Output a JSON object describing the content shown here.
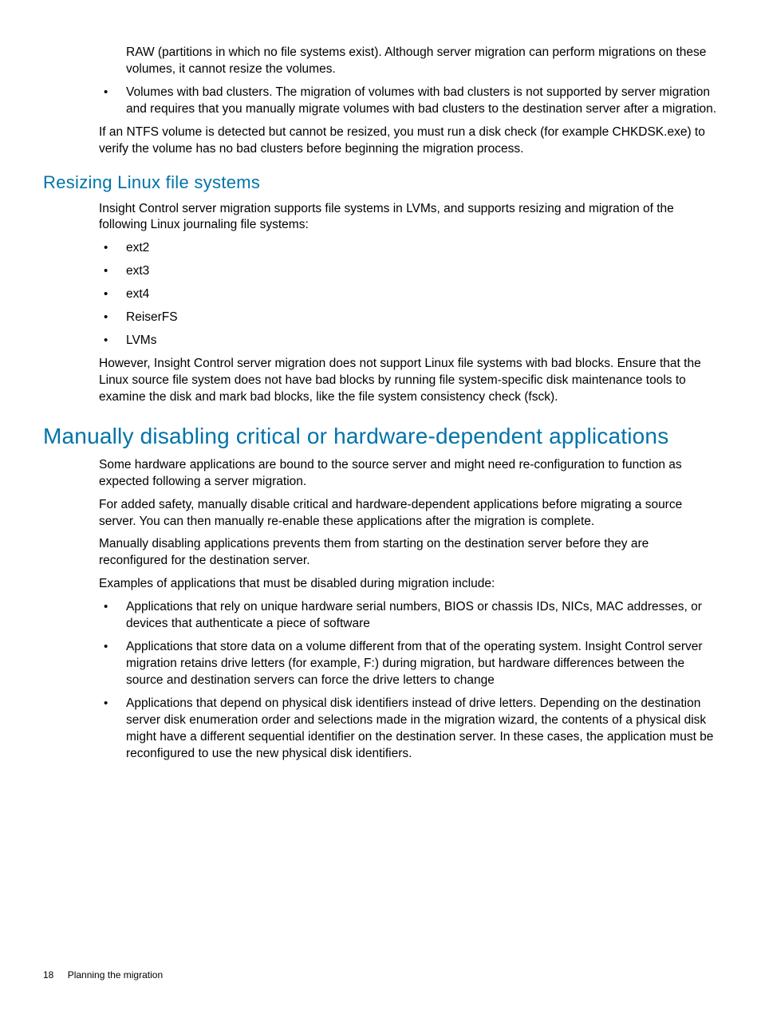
{
  "intro": {
    "raw_partition_text": "RAW (partitions in which no file systems exist). Although server migration can perform migrations on these volumes, it cannot resize the volumes.",
    "bad_clusters_text": "Volumes with bad clusters. The migration of volumes with bad clusters is not supported by server migration and requires that you manually migrate volumes with bad clusters to the destination server after a migration.",
    "ntfs_note": "If an NTFS volume is detected but cannot be resized, you must run a disk check (for example CHKDSK.exe) to verify the volume has no bad clusters before beginning the migration process."
  },
  "resizing_linux": {
    "heading": "Resizing Linux file systems",
    "intro": "Insight Control server migration supports file systems in LVMs, and supports resizing and migration of the following Linux journaling file systems:",
    "filesystems": {
      "fs0": "ext2",
      "fs1": "ext3",
      "fs2": "ext4",
      "fs3": "ReiserFS",
      "fs4": "LVMs"
    },
    "bad_blocks_note": "However, Insight Control server migration does not support Linux file systems with bad blocks. Ensure that the Linux source file system does not have bad blocks by running file system-specific disk maintenance tools to examine the disk and mark bad blocks, like the file system consistency check (fsck)."
  },
  "disabling_apps": {
    "heading": "Manually disabling critical or hardware-dependent applications",
    "para1": "Some hardware applications are bound to the source server and might need re-configuration to function as expected following a server migration.",
    "para2": "For added safety, manually disable critical and hardware-dependent applications before migrating a source server. You can then manually re-enable these applications after the migration is complete.",
    "para3": "Manually disabling applications prevents them from starting on the destination server before they are reconfigured for the destination server.",
    "para4": "Examples of applications that must be disabled during migration include:",
    "examples": {
      "ex0": "Applications that rely on unique hardware serial numbers, BIOS or chassis IDs, NICs, MAC addresses, or devices that authenticate a piece of software",
      "ex1": "Applications that store data on a volume different from that of the operating system. Insight Control server migration retains drive letters (for example, F:) during migration, but hardware differences between the source and destination servers can force the drive letters to change",
      "ex2": "Applications that depend on physical disk identifiers instead of drive letters. Depending on the destination server disk enumeration order and selections made in the migration wizard, the contents of a physical disk might have a different sequential identifier on the destination server. In these cases, the application must be reconfigured to use the new physical disk identifiers."
    }
  },
  "footer": {
    "page_number": "18",
    "section_title": "Planning the migration"
  }
}
